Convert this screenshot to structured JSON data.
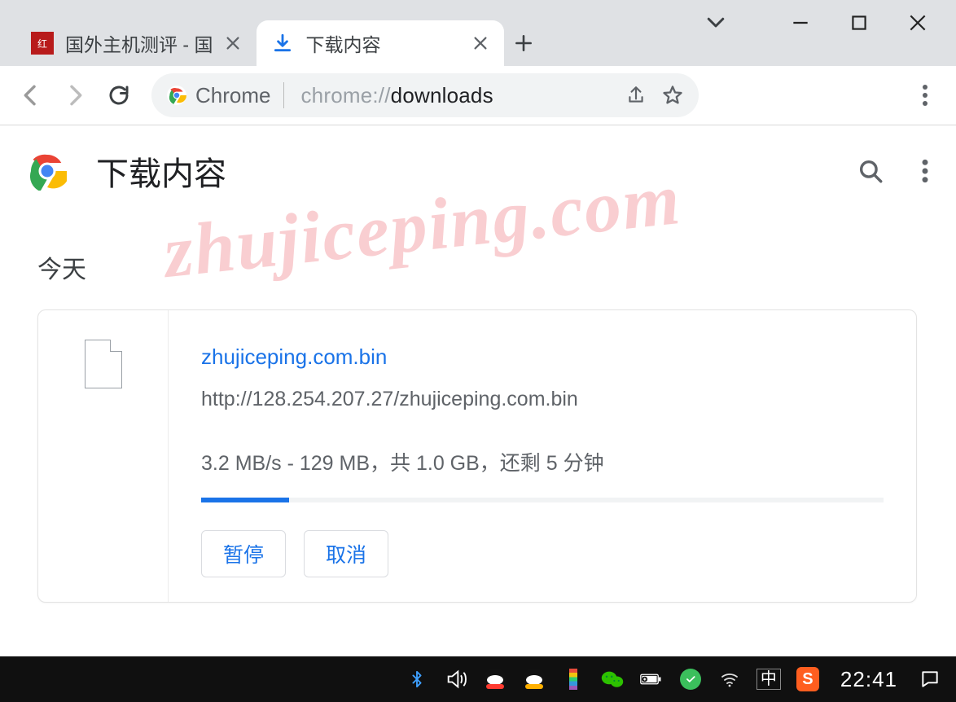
{
  "window": {
    "tabs": [
      {
        "title": "国外主机测评 - 国",
        "favicon": "red-block"
      },
      {
        "title": "下载内容",
        "favicon": "download"
      }
    ]
  },
  "omnibox": {
    "chip_label": "Chrome",
    "url_prefix": "chrome://",
    "url_bold": "downloads"
  },
  "page": {
    "title": "下载内容",
    "section": "今天"
  },
  "download": {
    "filename": "zhujiceping.com.bin",
    "source_url": "http://128.254.207.27/zhujiceping.com.bin",
    "progress_text": "3.2 MB/s - 129 MB，共 1.0 GB，还剩 5 分钟",
    "progress_percent": 12.9,
    "actions": {
      "pause": "暂停",
      "cancel": "取消"
    }
  },
  "watermark": "zhujiceping.com",
  "taskbar": {
    "ime": "中",
    "sogou": "S",
    "clock": "22:41"
  }
}
